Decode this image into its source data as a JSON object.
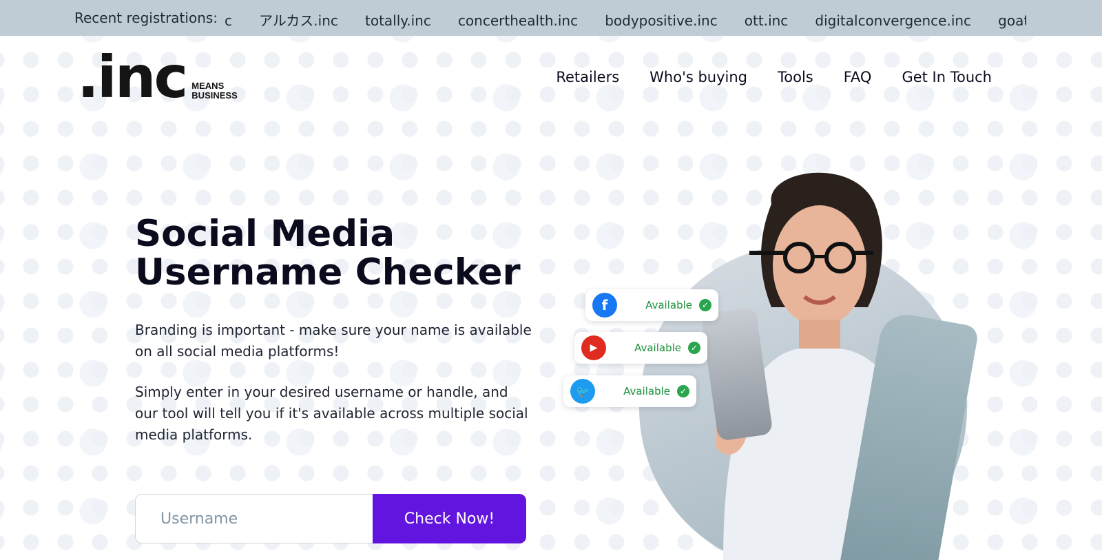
{
  "ticker": {
    "label": "Recent registrations:",
    "partial_item": "c",
    "items": [
      "アルカス.inc",
      "totally.inc",
      "concerthealth.inc",
      "bodypositive.inc",
      "ott.inc",
      "digitalconvergence.inc",
      "goat.inc"
    ]
  },
  "header": {
    "logo_mark": ".inc",
    "logo_tag_line1": "MEANS",
    "logo_tag_line2": "BUSINESS",
    "nav": [
      "Retailers",
      "Who's buying",
      "Tools",
      "FAQ",
      "Get In Touch"
    ]
  },
  "hero": {
    "title_line1": "Social Media",
    "title_line2": "Username Checker",
    "paragraph1": "Branding is important - make sure your name is available on all social media platforms!",
    "paragraph2": "Simply enter in your desired username or handle, and our tool will tell you if it's available across multiple social media platforms.",
    "input_placeholder": "Username",
    "button_label": "Check Now!"
  },
  "badges": [
    {
      "platform": "facebook-icon",
      "status": "Available",
      "color": "#1877f2"
    },
    {
      "platform": "youtube-icon",
      "status": "Available",
      "color": "#e02b20"
    },
    {
      "platform": "twitter-icon",
      "status": "Available",
      "color": "#1d9bf0"
    }
  ],
  "colors": {
    "accent": "#6315e0",
    "ticker_bg": "#bfccd5",
    "available": "#1a8f3b"
  }
}
